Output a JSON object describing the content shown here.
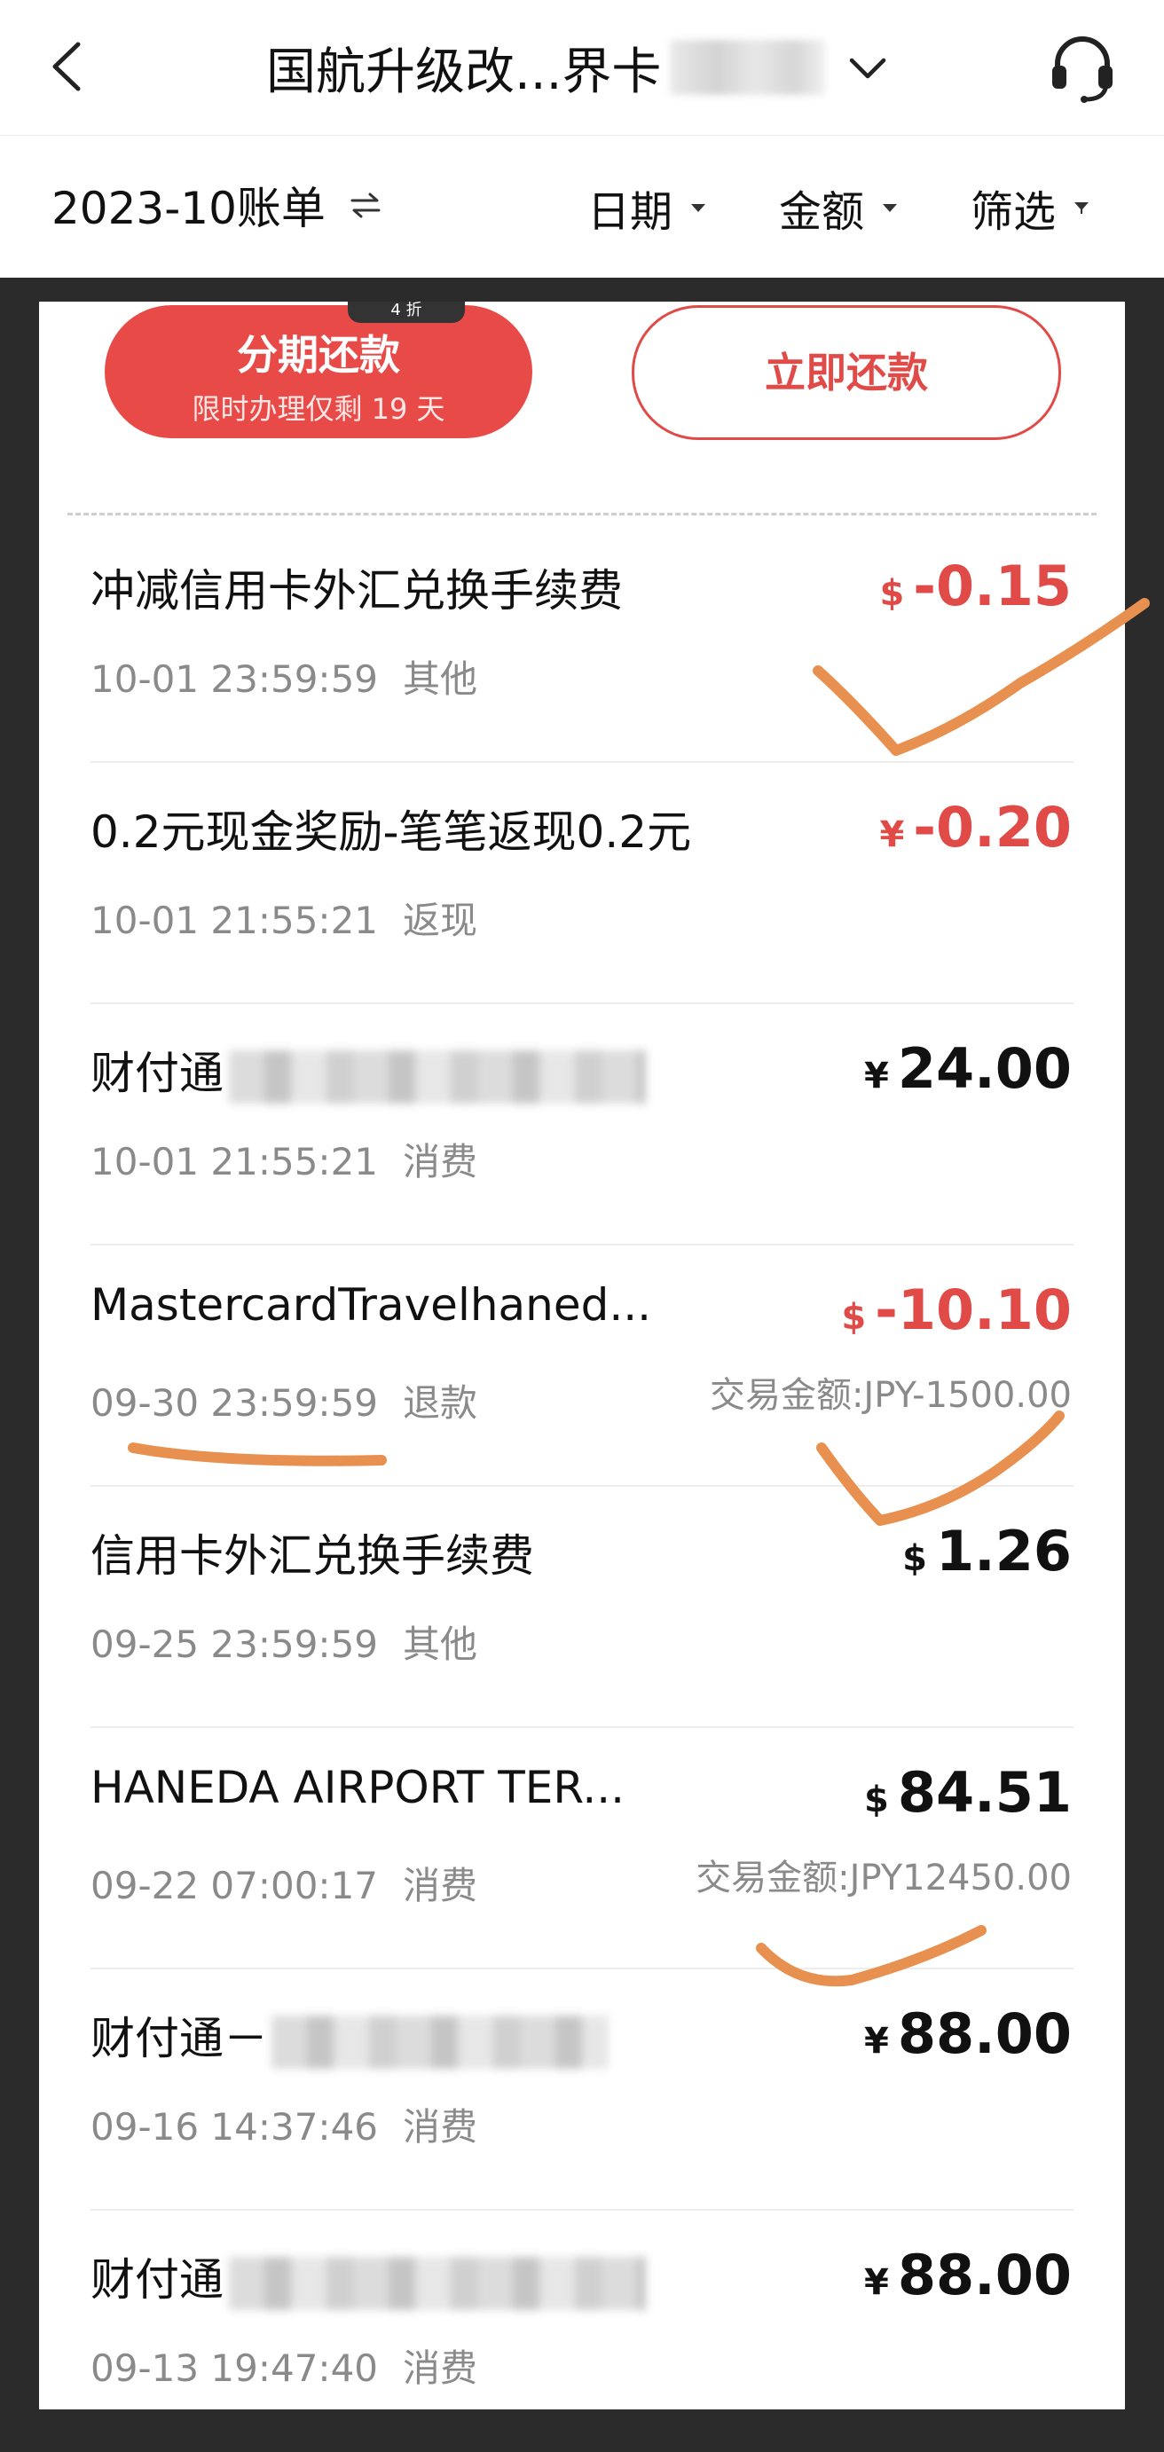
{
  "header": {
    "title": "国航升级改...界卡",
    "back_icon": "chevron-left-icon",
    "dropdown_icon": "chevron-down-icon",
    "service_icon": "headset-icon"
  },
  "filter_bar": {
    "month": "2023-10账单",
    "swap_symbol": "⇋",
    "date_label": "日期",
    "amount_label": "金额",
    "filter_label": "筛选"
  },
  "actions": {
    "installment_label": "分期还款",
    "installment_sub": "限时办理仅剩 19 天",
    "badge": "4 折",
    "repay_label": "立即还款"
  },
  "colors": {
    "accent_red": "#e84a48",
    "annotation_orange": "#e8904f"
  },
  "transactions": [
    {
      "desc": "冲减信用卡外汇兑换手续费",
      "time": "10-01 23:59:59",
      "category": "其他",
      "currency": "$",
      "amount": "-0.15",
      "negative": true
    },
    {
      "desc": "0.2元现金奖励-笔笔返现0.2元",
      "time": "10-01 21:55:21",
      "category": "返现",
      "currency": "¥",
      "amount": "-0.20",
      "negative": true
    },
    {
      "desc": "财付通",
      "time": "10-01 21:55:21",
      "category": "消费",
      "currency": "¥",
      "amount": "24.00",
      "negative": false
    },
    {
      "desc": "MastercardTravelhaned...",
      "time": "09-30 23:59:59",
      "category": "退款",
      "currency": "$",
      "amount": "-10.10",
      "negative": true,
      "trade": "交易金额:JPY-1500.00"
    },
    {
      "desc": "信用卡外汇兑换手续费",
      "time": "09-25 23:59:59",
      "category": "其他",
      "currency": "$",
      "amount": "1.26",
      "negative": false
    },
    {
      "desc": "HANEDA AIRPORT TER...",
      "time": "09-22 07:00:17",
      "category": "消费",
      "currency": "$",
      "amount": "84.51",
      "negative": false,
      "trade": "交易金额:JPY12450.00"
    },
    {
      "desc": "财付通－",
      "time": "09-16 14:37:46",
      "category": "消费",
      "currency": "¥",
      "amount": "88.00",
      "negative": false
    },
    {
      "desc": "财付通",
      "time": "09-13 19:47:40",
      "category": "消费",
      "currency": "¥",
      "amount": "88.00",
      "negative": false
    }
  ]
}
